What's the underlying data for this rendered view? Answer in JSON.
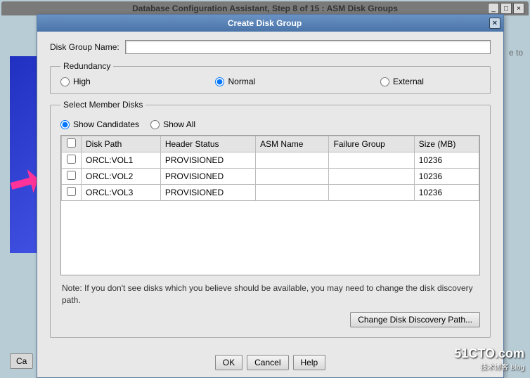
{
  "parentWindow": {
    "title": "Database Configuration Assistant, Step 8 of 15 : ASM Disk Groups"
  },
  "bg": {
    "eTo": "e to",
    "caBtn": "Ca"
  },
  "dialog": {
    "title": "Create Disk Group",
    "nameLabel": "Disk Group Name:",
    "nameValue": "",
    "redundancy": {
      "legend": "Redundancy",
      "options": {
        "high": "High",
        "normal": "Normal",
        "external": "External"
      },
      "selected": "normal"
    },
    "member": {
      "legend": "Select Member Disks",
      "filter": {
        "candidates": "Show Candidates",
        "all": "Show All",
        "selected": "candidates"
      },
      "columns": {
        "diskPath": "Disk Path",
        "headerStatus": "Header Status",
        "asmName": "ASM Name",
        "failureGroup": "Failure Group",
        "size": "Size (MB)"
      },
      "rows": [
        {
          "path": "ORCL:VOL1",
          "status": "PROVISIONED",
          "asm": "",
          "fg": "",
          "size": "10236"
        },
        {
          "path": "ORCL:VOL2",
          "status": "PROVISIONED",
          "asm": "",
          "fg": "",
          "size": "10236"
        },
        {
          "path": "ORCL:VOL3",
          "status": "PROVISIONED",
          "asm": "",
          "fg": "",
          "size": "10236"
        }
      ],
      "note": "Note: If you don't see disks which you believe should be available, you may need to change the disk discovery path.",
      "discoveryBtn": "Change Disk Discovery Path..."
    },
    "buttons": {
      "ok": "OK",
      "cancel": "Cancel",
      "help": "Help"
    }
  },
  "watermark": {
    "line1": "51CTO.com",
    "line2": "技术博客  Blog"
  }
}
